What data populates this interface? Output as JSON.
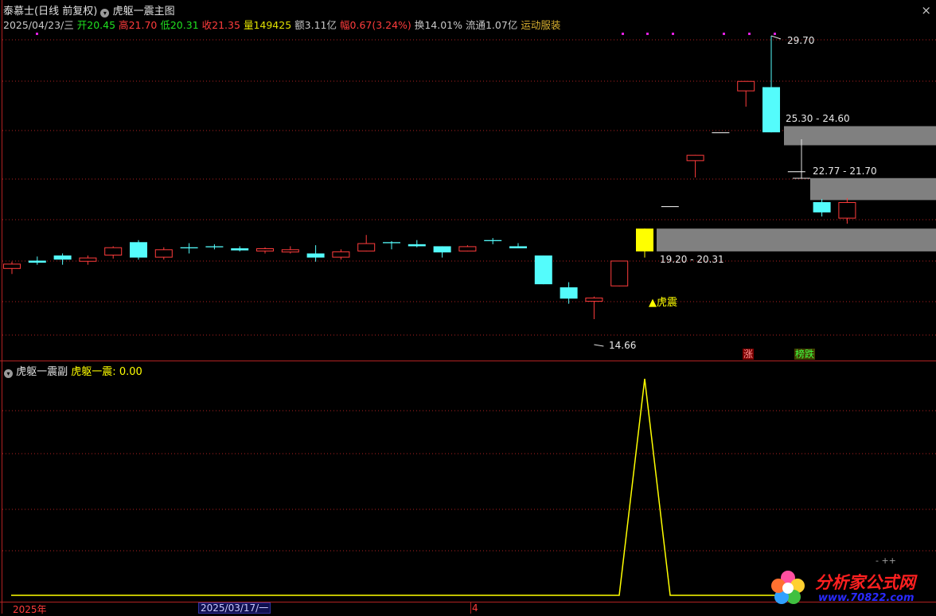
{
  "header": {
    "stock_name": "泰慕士",
    "period": "(日线 前复权)",
    "indicator_main": "虎躯一震主图",
    "date": "2025/04/23/三",
    "open_label": "开",
    "open": "20.45",
    "high_label": "高",
    "high": "21.70",
    "low_label": "低",
    "low": "20.31",
    "close_label": "收",
    "close": "21.35",
    "vol_label": "量",
    "vol": "149425",
    "amount_label": "额",
    "amount": "3.11亿",
    "change_label": "幅",
    "change": "0.67(3.24%)",
    "turnover_label": "换",
    "turnover": "14.01%",
    "float_label": "流通",
    "float_val": "1.07亿",
    "sector": "运动服装"
  },
  "annotations": {
    "high_price": "29.70",
    "low_price": "14.66",
    "zone1": "25.30 - 24.60",
    "zone2": "22.77 - 21.70",
    "zone3": "19.20 - 20.31",
    "signal": "▲虎震",
    "badge_up": "涨",
    "badge_board": "榜跌"
  },
  "sub_header": {
    "panel_name": "虎躯一震副",
    "indicator": "虎躯一震:",
    "value": "0.00"
  },
  "footer": {
    "year_label": "2025年",
    "date_box": "2025/03/17/一",
    "month_label": "4"
  },
  "watermark": {
    "title": "分析家公式网",
    "url": "www.70822.com"
  },
  "colors": {
    "up": "#ff3c3c",
    "down": "#54fcfc",
    "yellow": "#ffff00",
    "grid": "#b22222",
    "zone": "#808080"
  },
  "chart_data": {
    "type": "candlestick",
    "ylim": [
      14,
      31
    ],
    "candles": [
      {
        "o": 18.35,
        "c": 18.6,
        "h": 18.7,
        "l": 18.1
      },
      {
        "o": 18.75,
        "c": 18.65,
        "h": 18.95,
        "l": 18.55
      },
      {
        "o": 19.0,
        "c": 18.8,
        "h": 19.1,
        "l": 18.55
      },
      {
        "o": 18.7,
        "c": 18.9,
        "h": 19.0,
        "l": 18.55
      },
      {
        "o": 19.0,
        "c": 19.4,
        "h": 19.45,
        "l": 18.85
      },
      {
        "o": 19.65,
        "c": 18.9,
        "h": 19.75,
        "l": 18.8
      },
      {
        "o": 18.9,
        "c": 19.3,
        "h": 19.4,
        "l": 18.8
      },
      {
        "o": 19.4,
        "c": 19.35,
        "h": 19.6,
        "l": 19.1
      },
      {
        "o": 19.45,
        "c": 19.4,
        "h": 19.55,
        "l": 19.3
      },
      {
        "o": 19.35,
        "c": 19.25,
        "h": 19.45,
        "l": 19.2
      },
      {
        "o": 19.2,
        "c": 19.35,
        "h": 19.4,
        "l": 19.1
      },
      {
        "o": 19.15,
        "c": 19.3,
        "h": 19.45,
        "l": 19.1
      },
      {
        "o": 19.1,
        "c": 18.9,
        "h": 19.5,
        "l": 18.7
      },
      {
        "o": 18.9,
        "c": 19.2,
        "h": 19.3,
        "l": 18.8
      },
      {
        "o": 19.2,
        "c": 19.6,
        "h": 20.0,
        "l": 19.2
      },
      {
        "o": 19.65,
        "c": 19.6,
        "h": 19.7,
        "l": 19.3
      },
      {
        "o": 19.55,
        "c": 19.45,
        "h": 19.75,
        "l": 19.4
      },
      {
        "o": 19.45,
        "c": 19.15,
        "h": 19.45,
        "l": 18.9
      },
      {
        "o": 19.2,
        "c": 19.45,
        "h": 19.5,
        "l": 19.2
      },
      {
        "o": 19.75,
        "c": 19.7,
        "h": 19.85,
        "l": 19.55
      },
      {
        "o": 19.45,
        "c": 19.35,
        "h": 19.6,
        "l": 19.35
      },
      {
        "o": 19.0,
        "c": 17.6,
        "h": 19.0,
        "l": 17.6
      },
      {
        "o": 17.45,
        "c": 16.9,
        "h": 17.7,
        "l": 16.65
      },
      {
        "o": 16.75,
        "c": 16.95,
        "h": 17.0,
        "l": 15.9
      },
      {
        "o": 17.5,
        "c": 18.75,
        "h": 18.75,
        "l": 17.5
      },
      {
        "o": 20.31,
        "c": 19.2,
        "h": 20.31,
        "l": 18.9
      },
      {
        "o": 21.4,
        "c": 21.4,
        "h": 21.4,
        "l": 21.4
      },
      {
        "o": 23.6,
        "c": 23.9,
        "h": 23.9,
        "l": 22.8
      },
      {
        "o": 25.0,
        "c": 25.0,
        "h": 25.0,
        "l": 25.0
      },
      {
        "o": 27.0,
        "c": 27.5,
        "h": 27.5,
        "l": 26.25
      },
      {
        "o": 27.2,
        "c": 25.0,
        "h": 29.7,
        "l": 25.0
      },
      {
        "o": 23.1,
        "c": 23.1,
        "h": 23.1,
        "l": 23.1
      },
      {
        "o": 21.6,
        "c": 21.1,
        "h": 21.75,
        "l": 20.9
      },
      {
        "o": 20.8,
        "c": 21.6,
        "h": 21.8,
        "l": 20.55
      }
    ],
    "zones": [
      {
        "from": 19.2,
        "to": 20.31,
        "label": "19.20 - 20.31"
      },
      {
        "from": 21.7,
        "to": 22.77,
        "label": "22.77 - 21.70"
      },
      {
        "from": 24.6,
        "to": 25.3,
        "label": "25.30 - 24.60"
      }
    ],
    "signal": {
      "index": 25,
      "label": "▲虎震"
    },
    "sub_series": {
      "name": "虎躯一震",
      "spike_index": 25,
      "spike_value": 1,
      "base_value": 0
    }
  }
}
